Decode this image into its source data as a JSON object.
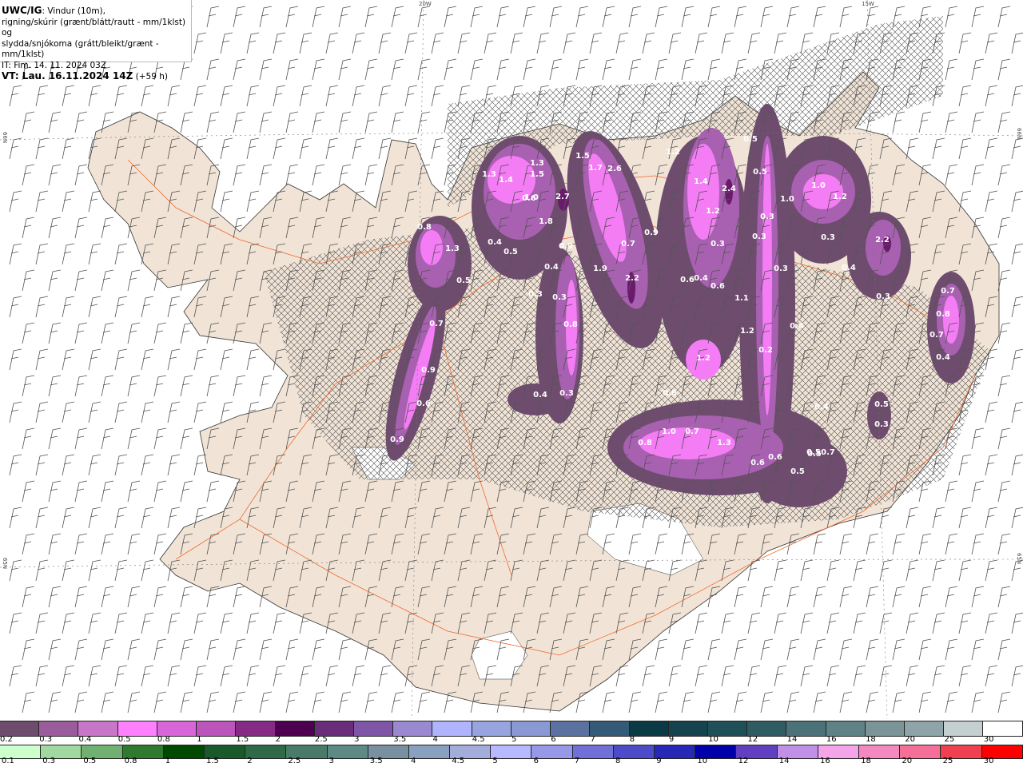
{
  "header": {
    "product": "UWC/IG",
    "line1": ": Vindur (10m),",
    "line2": "rigning/skúrir (grænt/blátt/rautt - mm/1klst) og",
    "line3": "slydda/snjókoma (grátt/bleikt/grænt - mm/1klst)",
    "issue_time": "IT: Fim. 14. 11. 2024 03Z",
    "valid_time": "VT: Lau. 16.11.2024 14Z",
    "lead_time": "(+59 h)"
  },
  "map": {
    "land_color": "#f1e4d6",
    "road_color": "#f06a30",
    "precip_colors": {
      "light": "#6e4c6e",
      "medium": "#a860b0",
      "heavy": "#f47cf4",
      "max": "#6a1a6a"
    },
    "grid_labels": {
      "lon_20w": "20W",
      "lon_15w": "15W",
      "lat_66n_left": "66N",
      "lat_65n_left": "65N",
      "lat_66n_right": "66N",
      "lat_65n_right": "65N"
    },
    "precip_values": [
      "0.8",
      "1.3",
      "0.5",
      "0.7",
      "0.9",
      "0.6",
      "0.9",
      "1.3",
      "1.3",
      "1.4",
      "1.5",
      "1.0",
      "0.6",
      "2.7",
      "1.8",
      "0.4",
      "0.5",
      "0.9",
      "0.4",
      "0.3",
      "0.3",
      "0.8",
      "1.5",
      "1.7",
      "2.6",
      "1.9",
      "0.7",
      "2.2",
      "0.9",
      "1.2",
      "1.4",
      "2.4",
      "1.2",
      "0.3",
      "0.6",
      "0.4",
      "0.6",
      "0.5",
      "0.5",
      "1.0",
      "1.0",
      "1.2",
      "0.3",
      "0.3",
      "0.3",
      "0.3",
      "2.2",
      "0.4",
      "0.3",
      "1.1",
      "1.2",
      "0.2",
      "0.4",
      "1.2",
      "0.8",
      "1.0",
      "0.7",
      "0.8",
      "1.3",
      "0.6",
      "0.6",
      "0.5",
      "0.4",
      "0.5",
      "0.7",
      "0.5",
      "0.5",
      "0.3",
      "0.7",
      "0.8",
      "0.7",
      "0.4",
      "0.4",
      "0.3"
    ]
  },
  "legend": {
    "snow": {
      "labels": [
        "0.2",
        "0.3",
        "0.4",
        "0.5",
        "0.8",
        "1",
        "1.5",
        "2",
        "2.5",
        "3",
        "3.5",
        "4",
        "4.5",
        "5",
        "6",
        "7",
        "8",
        "9",
        "10",
        "12",
        "14",
        "16",
        "18",
        "20",
        "25",
        "30"
      ],
      "colors": [
        "#6e4c6e",
        "#9a5c9a",
        "#c877c8",
        "#ff80ff",
        "#d966d9",
        "#bb55bb",
        "#852a85",
        "#4e0050",
        "#6a2d7a",
        "#7f55a8",
        "#9a88d0",
        "#b0b4ff",
        "#98a4e0",
        "#8a99d4",
        "#5b72a0",
        "#355a78",
        "#0a3a44",
        "#15444e",
        "#1f5058",
        "#2f5c62",
        "#4a7278",
        "#5e8286",
        "#7a9498",
        "#8ea4a8",
        "#c4cfd0",
        "#ffffff"
      ]
    },
    "rain": {
      "labels": [
        "0.1",
        "0.3",
        "0.5",
        "0.8",
        "1",
        "1.5",
        "2",
        "2.5",
        "3",
        "3.5",
        "4",
        "4.5",
        "5",
        "6",
        "7",
        "8",
        "9",
        "10",
        "12",
        "14",
        "16",
        "18",
        "20",
        "25",
        "30"
      ],
      "colors": [
        "#ccffcc",
        "#a0d8a0",
        "#70b070",
        "#2f7a2f",
        "#004a00",
        "#1a5a2a",
        "#2e6a48",
        "#4a7a68",
        "#5e8a84",
        "#7890a0",
        "#8aa0c0",
        "#a4acdc",
        "#b8b8ff",
        "#9898e8",
        "#7070d8",
        "#4c4cc8",
        "#2828b8",
        "#0000aa",
        "#6040c0",
        "#c090e8",
        "#f4a4e8",
        "#f488c0",
        "#f47098",
        "#f04050",
        "#ff0000"
      ]
    }
  }
}
